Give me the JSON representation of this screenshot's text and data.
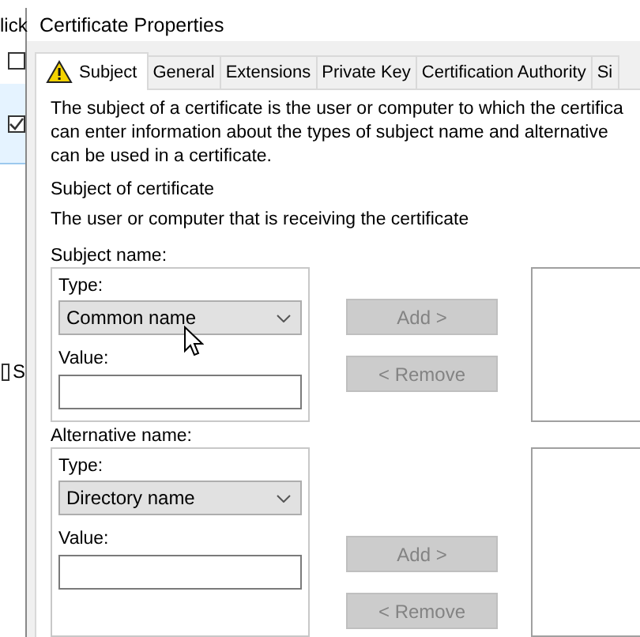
{
  "background_window": {
    "text": "lick",
    "rows": [
      {
        "checked": false,
        "selected": false
      },
      {
        "checked": true,
        "selected": true
      }
    ],
    "bottom_checkbox": {
      "label": "S",
      "checked": false
    }
  },
  "dialog": {
    "title": "Certificate Properties",
    "tabs": [
      {
        "label": "Subject",
        "selected": true,
        "warning": true
      },
      {
        "label": "General",
        "selected": false,
        "warning": false
      },
      {
        "label": "Extensions",
        "selected": false,
        "warning": false
      },
      {
        "label": "Private Key",
        "selected": false,
        "warning": false
      },
      {
        "label": "Certification Authority",
        "selected": false,
        "warning": false
      },
      {
        "label": "Si",
        "selected": false,
        "warning": false
      }
    ],
    "description": [
      "The subject of a certificate is the user or computer to which the certifica",
      "can enter information about the types of subject name and alternative",
      "can be used in a certificate."
    ],
    "section_title": "Subject of certificate",
    "section_hint": "The user or computer that is receiving the certificate",
    "groups": [
      {
        "label": "Subject name:",
        "type_label": "Type:",
        "type_value": "Common name",
        "value_label": "Value:",
        "buttons": [
          {
            "label": "Add >",
            "disabled": true
          },
          {
            "label": "< Remove",
            "disabled": true
          }
        ]
      },
      {
        "label": "Alternative name:",
        "type_label": "Type:",
        "type_value": "Directory name",
        "value_label": "Value:",
        "buttons": [
          {
            "label": "Add >",
            "disabled": true
          },
          {
            "label": "< Remove",
            "disabled": true
          }
        ]
      }
    ]
  }
}
